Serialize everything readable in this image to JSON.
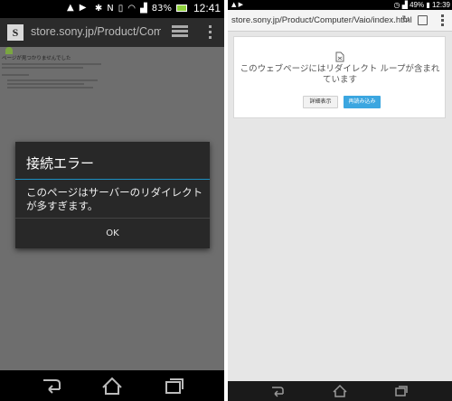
{
  "left": {
    "status": {
      "battery_pct": "83%",
      "time": "12:41"
    },
    "toolbar": {
      "url": "store.sony.jp/Product/Computer",
      "logo_letter": "S"
    },
    "page": {
      "title": "ページが見つかりませんでした"
    },
    "dialog": {
      "title": "接続エラー",
      "message": "このページはサーバーのリダイレクトが多すぎます。",
      "ok_label": "OK"
    }
  },
  "right": {
    "status": {
      "battery_pct": "49%",
      "time": "12:39"
    },
    "toolbar": {
      "url": "store.sony.jp/Product/Computer/Vaio/index.html"
    },
    "error": {
      "message": "このウェブページにはリダイレクト ループが含まれています",
      "details_label": "詳細表示",
      "reload_label": "再読み込み"
    }
  },
  "colors": {
    "dialog_accent": "#1c8fc2",
    "reload_button": "#3ba6e0",
    "battery_fill": "#8fd13c"
  }
}
